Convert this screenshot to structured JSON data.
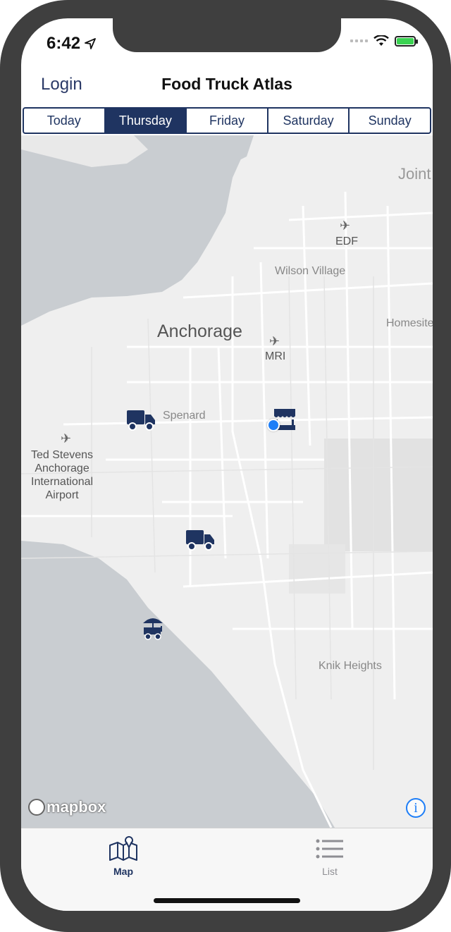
{
  "status_bar": {
    "time": "6:42"
  },
  "nav": {
    "login_label": "Login",
    "title": "Food Truck Atlas"
  },
  "day_tabs": [
    {
      "label": "Today",
      "selected": false
    },
    {
      "label": "Thursday",
      "selected": true
    },
    {
      "label": "Friday",
      "selected": false
    },
    {
      "label": "Saturday",
      "selected": false
    },
    {
      "label": "Sunday",
      "selected": false
    }
  ],
  "map": {
    "place_labels": {
      "anchorage": "Anchorage",
      "spenard": "Spenard",
      "wilson_village": "Wilson Village",
      "homesite": "Homesite",
      "knik_heights": "Knik Heights",
      "joint": "Joint",
      "airport_edf": "EDF",
      "airport_mri": "MRI",
      "airport_anc": "Ted Stevens\nAnchorage\nInternational\nAirport"
    },
    "markers": [
      {
        "type": "truck-icon"
      },
      {
        "type": "food-stand-icon"
      },
      {
        "type": "truck-icon"
      },
      {
        "type": "food-cart-icon"
      }
    ],
    "attribution": "mapbox",
    "accent_color": "#1f3461",
    "user_location_color": "#1e7ef7"
  },
  "tab_bar": {
    "map_label": "Map",
    "list_label": "List"
  }
}
